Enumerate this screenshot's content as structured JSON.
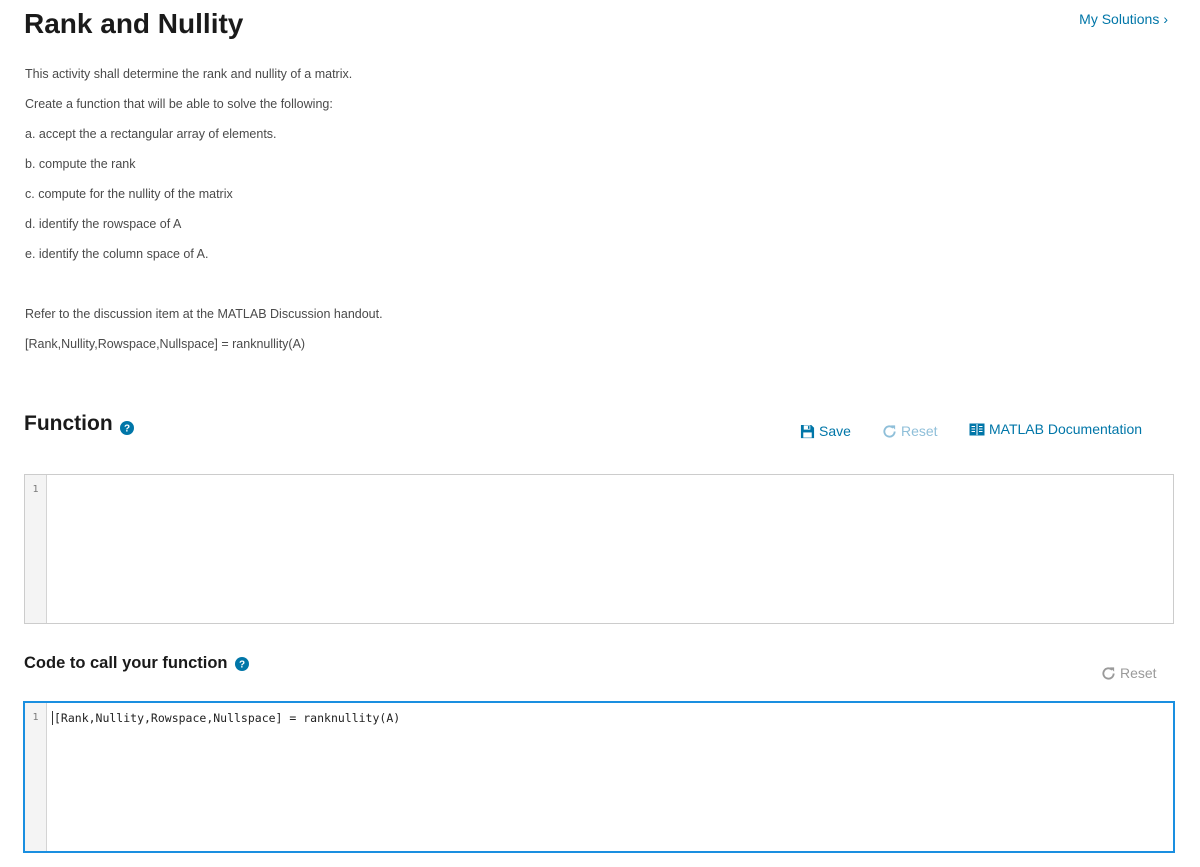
{
  "page": {
    "title": "Rank and Nullity",
    "my_solutions_label": "My Solutions",
    "my_solutions_chevron": "›"
  },
  "description": {
    "lines": [
      "This activity shall determine the rank and nullity of a matrix.",
      "Create a function that will be able to solve the following:",
      "a. accept the a rectangular array of elements.",
      "b. compute the rank",
      "c. compute for the nullity of the matrix",
      "d. identify the rowspace of A",
      "e. identify the column space of A.",
      "",
      "Refer to the discussion item at the MATLAB Discussion handout.",
      "[Rank,Nullity,Rowspace,Nullspace] = ranknullity(A)"
    ]
  },
  "function_section": {
    "heading": "Function",
    "help_icon": "question-circle-icon",
    "save_label": "Save",
    "save_icon": "floppy-disk-icon",
    "reset_label": "Reset",
    "reset_icon": "refresh-icon",
    "docs_label": "MATLAB Documentation",
    "docs_icon": "book-icon",
    "editor": {
      "line_numbers": [
        "1"
      ],
      "code": ""
    }
  },
  "call_section": {
    "heading": "Code to call your function",
    "help_icon": "question-circle-icon",
    "reset_label": "Reset",
    "reset_icon": "refresh-icon",
    "editor": {
      "line_numbers": [
        "1"
      ],
      "code": "[Rank,Nullity,Rowspace,Nullspace] = ranknullity(A)"
    }
  },
  "colors": {
    "link": "#0076a8",
    "disabled_link": "#8fbfd9",
    "focus_border": "#1a8fe0"
  }
}
